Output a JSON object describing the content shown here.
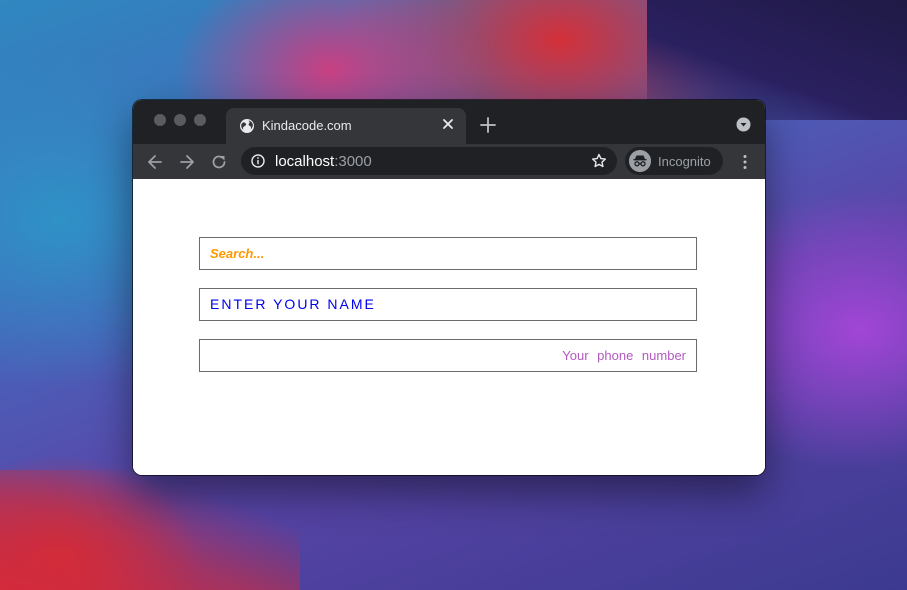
{
  "browser": {
    "tab": {
      "title": "Kindacode.com"
    },
    "address": {
      "host": "localhost",
      "port": ":3000"
    },
    "profile": {
      "label": "Incognito"
    }
  },
  "form": {
    "search": {
      "placeholder": "Search..."
    },
    "name": {
      "placeholder": "Enter your name"
    },
    "phone": {
      "placeholder": "Your phone number"
    }
  },
  "colors": {
    "search_placeholder": "#ff9900",
    "name_placeholder": "#0000ee",
    "phone_placeholder": "#b25ac0",
    "chrome_dark": "#202124",
    "chrome_toolbar": "#35363a"
  },
  "icons": [
    "globe-icon",
    "close-icon",
    "plus-icon",
    "tab-search-icon",
    "back-arrow-icon",
    "forward-arrow-icon",
    "reload-icon",
    "info-icon",
    "star-icon",
    "incognito-icon",
    "more-vertical-icon"
  ]
}
